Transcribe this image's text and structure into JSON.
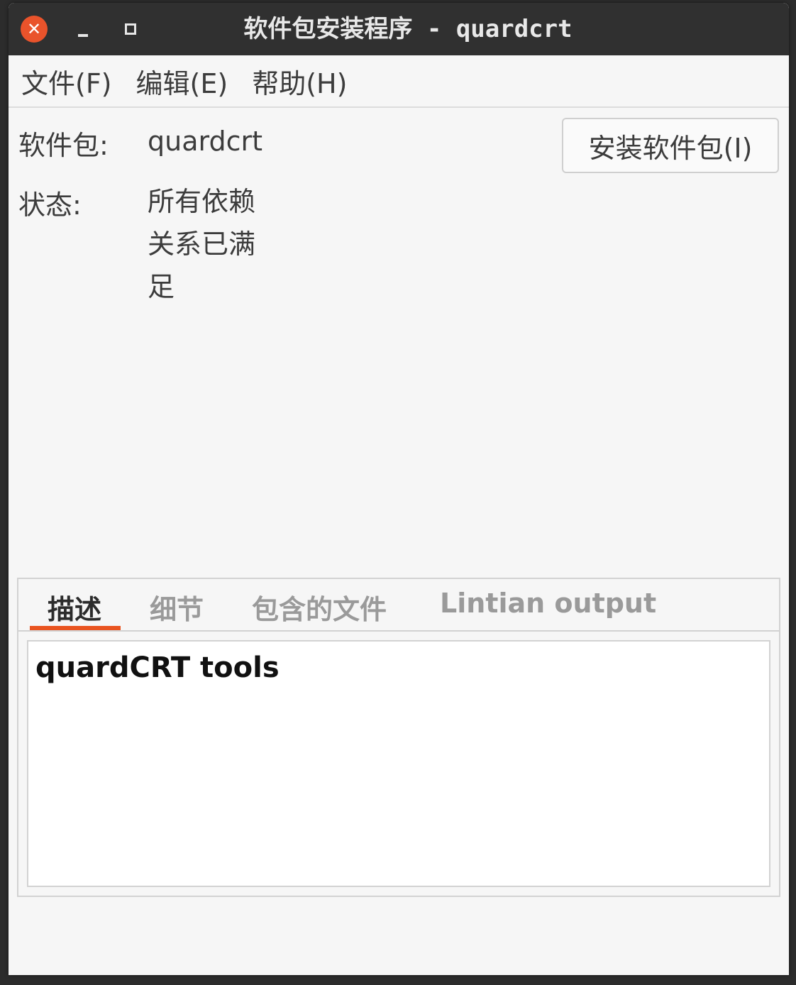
{
  "window": {
    "title": "软件包安装程序 - quardcrt",
    "close_symbol": "✕",
    "accent_color": "#e95420"
  },
  "menubar": {
    "items": [
      "文件(F)",
      "编辑(E)",
      "帮助(H)"
    ]
  },
  "package": {
    "label": "软件包:",
    "name": "quardcrt",
    "status_label": "状态:",
    "status_lines": [
      "所有依赖",
      "关系已满",
      "足"
    ],
    "install_button": "安装软件包(I)"
  },
  "tabs": {
    "items": [
      "描述",
      "细节",
      "包含的文件",
      "Lintian output"
    ],
    "active_index": 0
  },
  "description": {
    "text": "quardCRT tools"
  }
}
